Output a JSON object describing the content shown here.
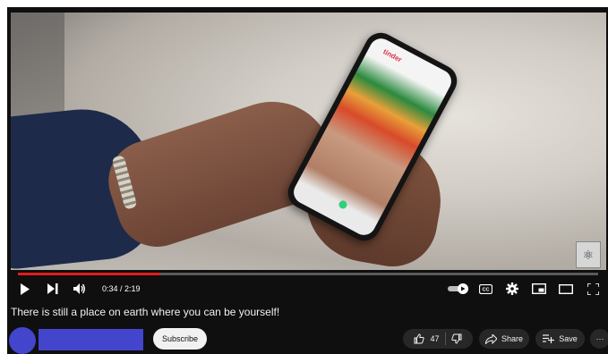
{
  "player": {
    "current_time": "0:34",
    "duration": "2:19",
    "time_display": "0:34 / 2:19",
    "progress": 0.245,
    "accent_color": "#e11d1d",
    "controls": [
      "play-icon",
      "next-icon",
      "volume-icon",
      "autoplay-toggle",
      "captions-icon",
      "settings-icon",
      "miniplayer-icon",
      "theater-icon",
      "fullscreen-icon"
    ]
  },
  "scene": {
    "app_tag": "tinder"
  },
  "video": {
    "title": "There is still a place on earth where you can be yourself!"
  },
  "channel": {
    "subscribe_label": "Subscribe"
  },
  "actions": {
    "like_count": "47",
    "share_label": "Share",
    "save_label": "Save",
    "more_label": "···"
  }
}
